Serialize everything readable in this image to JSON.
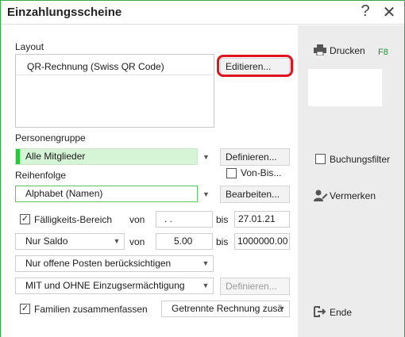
{
  "window": {
    "title": "Einzahlungsscheine"
  },
  "titlebar": {
    "help_label": "?",
    "close_label": "✕"
  },
  "layout": {
    "label": "Layout",
    "selected_item": "QR-Rechnung (Swiss QR Code)",
    "edit_button": "Editieren..."
  },
  "personengruppe": {
    "label": "Personengruppe",
    "value": "Alle Mitglieder",
    "define_button": "Definieren...",
    "von_bis_label": "Von-Bis..."
  },
  "reihenfolge": {
    "label": "Reihenfolge",
    "value": "Alphabet (Namen)",
    "edit_button": "Bearbeiten..."
  },
  "faelligkeit": {
    "checkbox_label": "Fälligkeits-Bereich",
    "checked": true,
    "from_label": "von",
    "from_value": " .  .",
    "to_label": "bis",
    "to_value": "27.01.21"
  },
  "saldo": {
    "value": "Nur Saldo",
    "from_label": "von",
    "from_value": "5.00",
    "to_label": "bis",
    "to_value": "1000000.00"
  },
  "posten": {
    "value": "Nur offene Posten berücksichtigen"
  },
  "einzug": {
    "value": "MIT und OHNE Einzugsermächtigung",
    "define_button": "Definieren..."
  },
  "familien": {
    "checkbox_label": "Familien zusammenfassen",
    "checked": true,
    "rechnung_value": "Getrennte Rechnung zusä"
  },
  "side": {
    "print_label": "Drucken",
    "print_shortcut": "F8",
    "buchungsfilter_label": "Buchungsfilter",
    "vermerken_label": "Vermerken",
    "ende_label": "Ende"
  },
  "colors": {
    "accent": "#2cc43a",
    "highlight_ring": "#e0141e",
    "sidebar_bg": "#ececec"
  }
}
